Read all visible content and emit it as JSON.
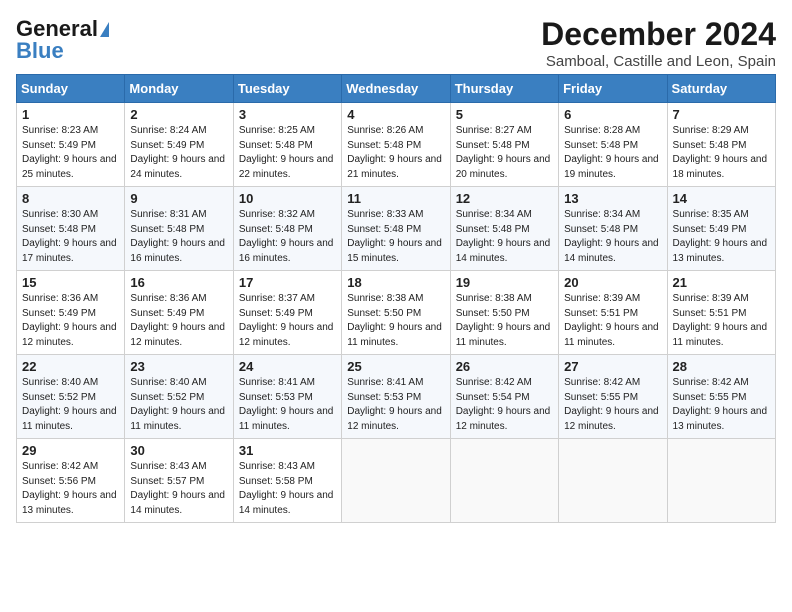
{
  "header": {
    "logo_general": "General",
    "logo_blue": "Blue",
    "month_title": "December 2024",
    "location": "Samboal, Castille and Leon, Spain"
  },
  "weekdays": [
    "Sunday",
    "Monday",
    "Tuesday",
    "Wednesday",
    "Thursday",
    "Friday",
    "Saturday"
  ],
  "weeks": [
    [
      {
        "day": "1",
        "sunrise": "8:23 AM",
        "sunset": "5:49 PM",
        "daylight": "9 hours and 25 minutes."
      },
      {
        "day": "2",
        "sunrise": "8:24 AM",
        "sunset": "5:49 PM",
        "daylight": "9 hours and 24 minutes."
      },
      {
        "day": "3",
        "sunrise": "8:25 AM",
        "sunset": "5:48 PM",
        "daylight": "9 hours and 22 minutes."
      },
      {
        "day": "4",
        "sunrise": "8:26 AM",
        "sunset": "5:48 PM",
        "daylight": "9 hours and 21 minutes."
      },
      {
        "day": "5",
        "sunrise": "8:27 AM",
        "sunset": "5:48 PM",
        "daylight": "9 hours and 20 minutes."
      },
      {
        "day": "6",
        "sunrise": "8:28 AM",
        "sunset": "5:48 PM",
        "daylight": "9 hours and 19 minutes."
      },
      {
        "day": "7",
        "sunrise": "8:29 AM",
        "sunset": "5:48 PM",
        "daylight": "9 hours and 18 minutes."
      }
    ],
    [
      {
        "day": "8",
        "sunrise": "8:30 AM",
        "sunset": "5:48 PM",
        "daylight": "9 hours and 17 minutes."
      },
      {
        "day": "9",
        "sunrise": "8:31 AM",
        "sunset": "5:48 PM",
        "daylight": "9 hours and 16 minutes."
      },
      {
        "day": "10",
        "sunrise": "8:32 AM",
        "sunset": "5:48 PM",
        "daylight": "9 hours and 16 minutes."
      },
      {
        "day": "11",
        "sunrise": "8:33 AM",
        "sunset": "5:48 PM",
        "daylight": "9 hours and 15 minutes."
      },
      {
        "day": "12",
        "sunrise": "8:34 AM",
        "sunset": "5:48 PM",
        "daylight": "9 hours and 14 minutes."
      },
      {
        "day": "13",
        "sunrise": "8:34 AM",
        "sunset": "5:48 PM",
        "daylight": "9 hours and 14 minutes."
      },
      {
        "day": "14",
        "sunrise": "8:35 AM",
        "sunset": "5:49 PM",
        "daylight": "9 hours and 13 minutes."
      }
    ],
    [
      {
        "day": "15",
        "sunrise": "8:36 AM",
        "sunset": "5:49 PM",
        "daylight": "9 hours and 12 minutes."
      },
      {
        "day": "16",
        "sunrise": "8:36 AM",
        "sunset": "5:49 PM",
        "daylight": "9 hours and 12 minutes."
      },
      {
        "day": "17",
        "sunrise": "8:37 AM",
        "sunset": "5:49 PM",
        "daylight": "9 hours and 12 minutes."
      },
      {
        "day": "18",
        "sunrise": "8:38 AM",
        "sunset": "5:50 PM",
        "daylight": "9 hours and 11 minutes."
      },
      {
        "day": "19",
        "sunrise": "8:38 AM",
        "sunset": "5:50 PM",
        "daylight": "9 hours and 11 minutes."
      },
      {
        "day": "20",
        "sunrise": "8:39 AM",
        "sunset": "5:51 PM",
        "daylight": "9 hours and 11 minutes."
      },
      {
        "day": "21",
        "sunrise": "8:39 AM",
        "sunset": "5:51 PM",
        "daylight": "9 hours and 11 minutes."
      }
    ],
    [
      {
        "day": "22",
        "sunrise": "8:40 AM",
        "sunset": "5:52 PM",
        "daylight": "9 hours and 11 minutes."
      },
      {
        "day": "23",
        "sunrise": "8:40 AM",
        "sunset": "5:52 PM",
        "daylight": "9 hours and 11 minutes."
      },
      {
        "day": "24",
        "sunrise": "8:41 AM",
        "sunset": "5:53 PM",
        "daylight": "9 hours and 11 minutes."
      },
      {
        "day": "25",
        "sunrise": "8:41 AM",
        "sunset": "5:53 PM",
        "daylight": "9 hours and 12 minutes."
      },
      {
        "day": "26",
        "sunrise": "8:42 AM",
        "sunset": "5:54 PM",
        "daylight": "9 hours and 12 minutes."
      },
      {
        "day": "27",
        "sunrise": "8:42 AM",
        "sunset": "5:55 PM",
        "daylight": "9 hours and 12 minutes."
      },
      {
        "day": "28",
        "sunrise": "8:42 AM",
        "sunset": "5:55 PM",
        "daylight": "9 hours and 13 minutes."
      }
    ],
    [
      {
        "day": "29",
        "sunrise": "8:42 AM",
        "sunset": "5:56 PM",
        "daylight": "9 hours and 13 minutes."
      },
      {
        "day": "30",
        "sunrise": "8:43 AM",
        "sunset": "5:57 PM",
        "daylight": "9 hours and 14 minutes."
      },
      {
        "day": "31",
        "sunrise": "8:43 AM",
        "sunset": "5:58 PM",
        "daylight": "9 hours and 14 minutes."
      },
      null,
      null,
      null,
      null
    ]
  ]
}
